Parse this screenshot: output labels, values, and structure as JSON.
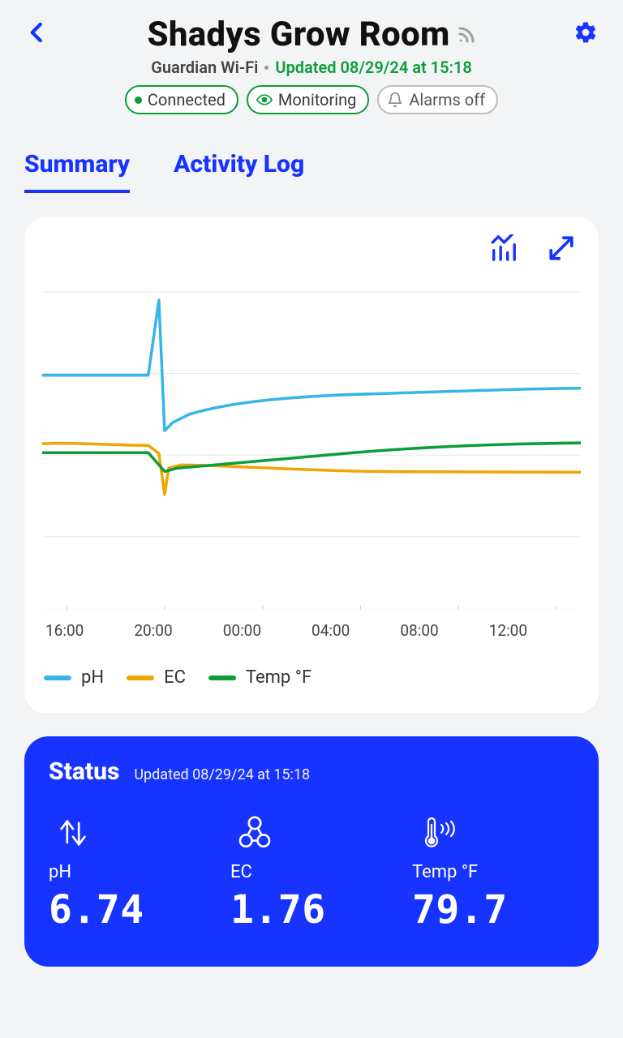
{
  "header": {
    "title": "Shadys Grow Room",
    "device": "Guardian Wi-Fi",
    "updated": "Updated 08/29/24 at 15:18",
    "badges": {
      "connected": "Connected",
      "monitoring": "Monitoring",
      "alarms": "Alarms off"
    }
  },
  "tabs": {
    "summary": "Summary",
    "activity": "Activity Log"
  },
  "chart": {
    "legend": {
      "ph": "pH",
      "ec": "EC",
      "temp": "Temp °F"
    },
    "x_ticks": [
      "16:00",
      "20:00",
      "00:00",
      "04:00",
      "08:00",
      "12:00"
    ]
  },
  "status": {
    "title": "Status",
    "updated": "Updated 08/29/24 at 15:18",
    "metrics": {
      "ph": {
        "label": "pH",
        "value": "6.74"
      },
      "ec": {
        "label": "EC",
        "value": "1.76"
      },
      "temp": {
        "label": "Temp °F",
        "value": "79.7"
      }
    }
  },
  "chart_data": {
    "type": "line",
    "title": "",
    "xlabel": "Time",
    "ylabel": "",
    "x": [
      "16:00",
      "17:00",
      "18:00",
      "19:00",
      "19:30",
      "19:45",
      "20:00",
      "21:00",
      "22:00",
      "00:00",
      "02:00",
      "04:00",
      "06:00",
      "08:00",
      "10:00",
      "12:00",
      "14:00"
    ],
    "series": [
      {
        "name": "pH",
        "color": "#36b6e6",
        "values": [
          6.95,
          6.95,
          6.95,
          6.95,
          7.55,
          6.3,
          6.4,
          6.5,
          6.57,
          6.62,
          6.65,
          6.68,
          6.7,
          6.72,
          6.73,
          6.74,
          6.74
        ]
      },
      {
        "name": "EC",
        "color": "#f0a500",
        "values": [
          2.02,
          2.02,
          2.02,
          2.02,
          1.95,
          1.55,
          1.75,
          1.8,
          1.8,
          1.78,
          1.78,
          1.77,
          1.77,
          1.76,
          1.76,
          1.76,
          1.76
        ]
      },
      {
        "name": "Temp °F",
        "color": "#0b9d3a",
        "values": [
          78.5,
          78.5,
          78.5,
          78.5,
          78.5,
          77.5,
          78.0,
          78.2,
          78.4,
          78.7,
          79.0,
          79.2,
          79.4,
          79.5,
          79.6,
          79.7,
          79.7
        ]
      }
    ],
    "x_ticks": [
      "16:00",
      "20:00",
      "00:00",
      "04:00",
      "08:00",
      "12:00"
    ],
    "gridlines_y": 4
  }
}
